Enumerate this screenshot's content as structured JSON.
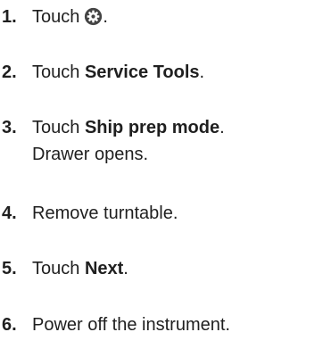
{
  "steps": [
    {
      "number": "1.",
      "prefix": "Touch",
      "icon": "gear-icon",
      "suffix": "."
    },
    {
      "number": "2.",
      "prefix": "Touch ",
      "bold": "Service Tools",
      "suffix": "."
    },
    {
      "number": "3.",
      "prefix": "Touch ",
      "bold": "Ship prep mode",
      "suffix": ".",
      "second_line": "Drawer opens."
    },
    {
      "number": "4.",
      "text": "Remove turntable."
    },
    {
      "number": "5.",
      "prefix": "Touch ",
      "bold": "Next",
      "suffix": "."
    },
    {
      "number": "6.",
      "text": "Power off the instrument."
    }
  ]
}
